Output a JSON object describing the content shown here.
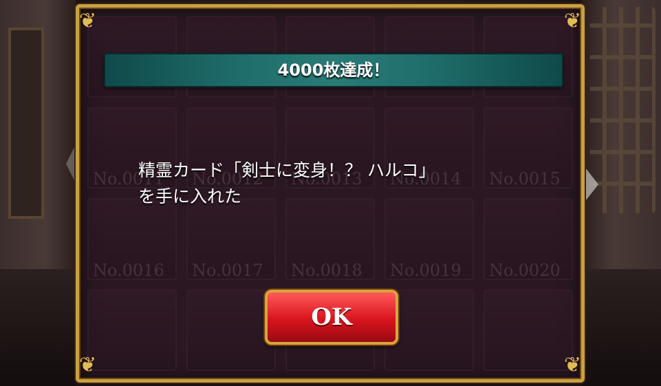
{
  "dialog": {
    "title": "4000枚達成！",
    "message_line1": "精霊カード「剣士に変身！？ ハルコ」",
    "message_line2": "を手に入れた",
    "ok_label": "OK"
  },
  "background_cards": [
    "",
    "",
    "",
    "",
    "",
    "No.0011",
    "No.0012",
    "No.0013",
    "No.0014",
    "No.0015",
    "No.0016",
    "No.0017",
    "No.0018",
    "No.0019",
    "No.0020",
    "",
    "",
    "",
    "",
    ""
  ],
  "colors": {
    "frame_gold": "#c9a043",
    "title_teal": "#1f6e6c",
    "button_red": "#d8141e"
  }
}
